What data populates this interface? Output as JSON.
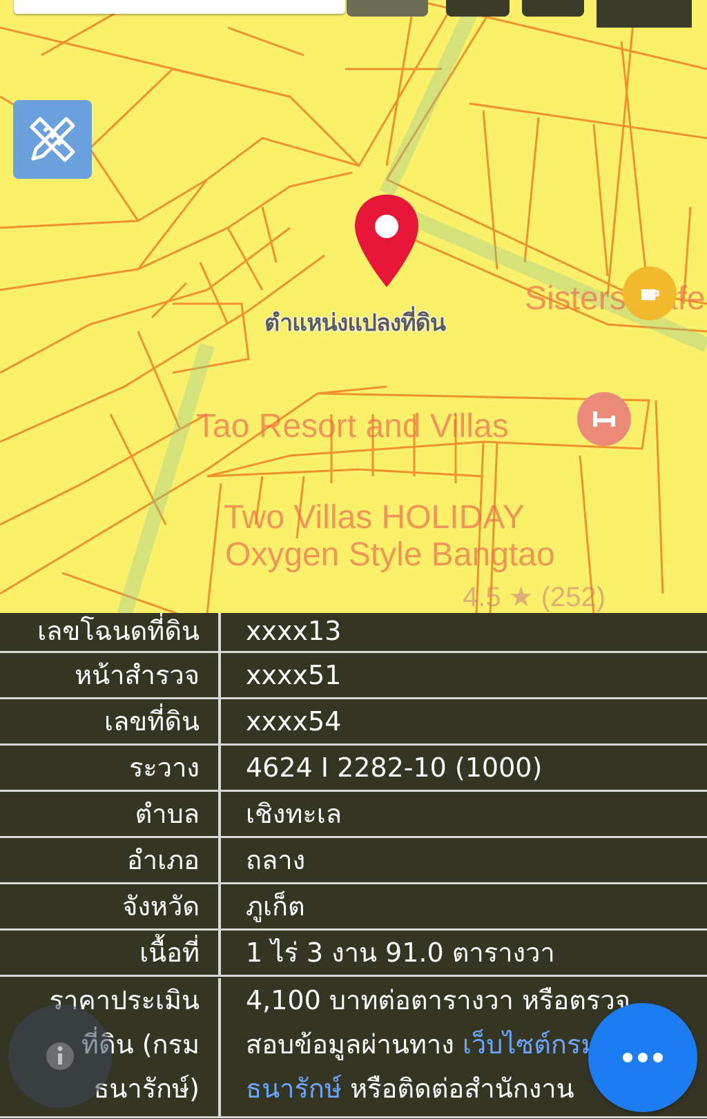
{
  "map": {
    "pin_label": "ตำแหน่งแปลงที่ดิน",
    "pois": [
      {
        "name": "Sisters Cafe",
        "icon": "cafe-icon"
      },
      {
        "name": "Tao Resort and Villas",
        "icon": "hotel-icon"
      },
      {
        "name": "Two Villas HOLIDAY\nOxygen Style Bangtao",
        "line1": "Two Villas HOLIDAY",
        "line2": "Oxygen Style Bangtao"
      }
    ],
    "rating": "4.5 ★ (252)",
    "colors": {
      "background": "#fbf06a",
      "parcel_lines": "#f0922a",
      "pin": "#e8173a",
      "measure_button": "#6aa0dc"
    }
  },
  "info": {
    "rows": [
      {
        "label": "เลขโฉนดที่ดิน",
        "value": "xxxx13"
      },
      {
        "label": "หน้าสำรวจ",
        "value": "xxxx51"
      },
      {
        "label": "เลขที่ดิน",
        "value": "xxxx54"
      },
      {
        "label": "ระวาง",
        "value": "4624 I 2282-10 (1000)"
      },
      {
        "label": "ตำบล",
        "value": "เชิงทะเล"
      },
      {
        "label": "อำเภอ",
        "value": "ถลาง"
      },
      {
        "label": "จังหวัด",
        "value": "ภูเก็ต"
      },
      {
        "label": "เนื้อที่",
        "value": "1 ไร่ 3 งาน 91.0 ตารางวา"
      }
    ],
    "price": {
      "label_lines": [
        "ราคาประเมิน",
        "ที่ดิน (กรม",
        "ธนารักษ์)"
      ],
      "line1": "4,100 บาทต่อตารางวา หรือตรวจ",
      "line2_prefix": "สอบข้อมูลผ่านทาง ",
      "line2_link": "เว็บไซต์กรม",
      "line3_link": "ธนารักษ์",
      "line3_suffix": " หรือติดต่อสำนักงาน"
    }
  },
  "buttons": {
    "info_icon": "info-icon",
    "more_icon": "more-dots-icon",
    "measure_icon": "ruler-pencil-icon"
  }
}
